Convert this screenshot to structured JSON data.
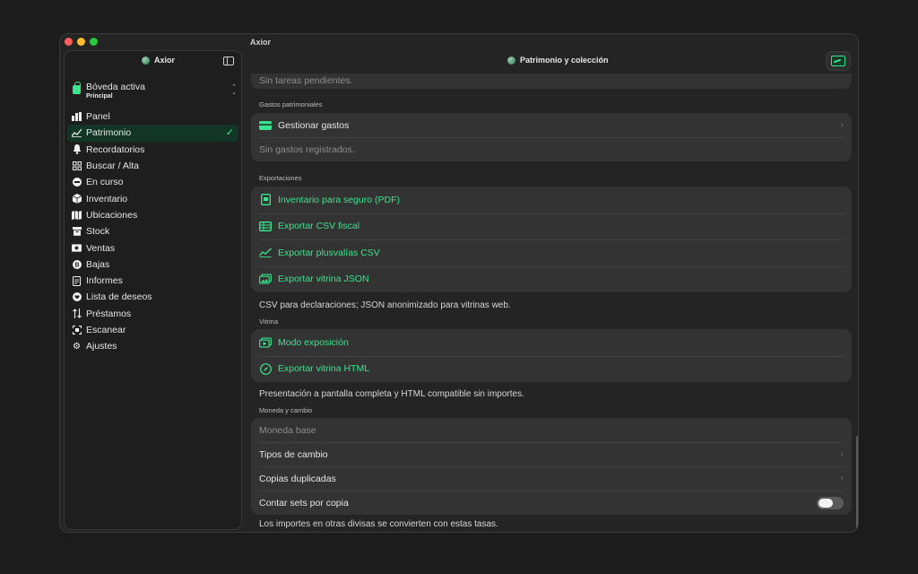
{
  "window": {
    "title": "Axior"
  },
  "sidebar": {
    "brand": "Axior",
    "vault": {
      "title": "Bóveda activa",
      "subtitle": "Principal"
    },
    "items": [
      {
        "label": "Panel",
        "icon": "chart-bars-icon",
        "active": false
      },
      {
        "label": "Patrimonio",
        "icon": "trend-line-icon",
        "active": true
      },
      {
        "label": "Recordatorios",
        "icon": "bell-icon",
        "active": false
      },
      {
        "label": "Buscar / Alta",
        "icon": "grid-icon",
        "active": false
      },
      {
        "label": "En curso",
        "icon": "clock-circle-icon",
        "active": false
      },
      {
        "label": "Inventario",
        "icon": "cube-icon",
        "active": false
      },
      {
        "label": "Ubicaciones",
        "icon": "map-icon",
        "active": false
      },
      {
        "label": "Stock",
        "icon": "archive-box-icon",
        "active": false
      },
      {
        "label": "Ventas",
        "icon": "cash-icon",
        "active": false
      },
      {
        "label": "Bajas",
        "icon": "minus-circle-icon",
        "active": false
      },
      {
        "label": "Informes",
        "icon": "document-icon",
        "active": false
      },
      {
        "label": "Lista de deseos",
        "icon": "heart-icon",
        "active": false
      },
      {
        "label": "Préstamos",
        "icon": "swap-arrows-icon",
        "active": false
      },
      {
        "label": "Escanear",
        "icon": "scan-icon",
        "active": false
      },
      {
        "label": "Ajustes",
        "icon": "gear-icon",
        "active": false
      }
    ]
  },
  "toolbar": {
    "title": "Patrimonio y colección"
  },
  "sections": {
    "pending": {
      "row": "Sin tareas pendientes."
    },
    "expenses": {
      "header": "Gastos patrimoniales",
      "manage": "Gestionar gastos",
      "empty": "Sin gastos registrados."
    },
    "exports": {
      "header": "Exportaciones",
      "items": [
        "Inventario para seguro (PDF)",
        "Exportar CSV fiscal",
        "Exportar plusvalías CSV",
        "Exportar vitrina JSON"
      ],
      "footnote": "CSV para declaraciones; JSON anonimizado para vitrinas web."
    },
    "showcase": {
      "header": "Vitrina",
      "items": [
        "Modo exposición",
        "Exportar vitrina HTML"
      ],
      "footnote": "Presentación a pantalla completa y HTML compatible sin importes."
    },
    "currency": {
      "header": "Moneda y cambio",
      "base": "Moneda base",
      "rates": "Tipos de cambio",
      "duplicates": "Copias duplicadas",
      "count_sets": "Contar sets por copia",
      "count_sets_enabled": false,
      "footnote": "Los importes en otras divisas se convierten con estas tasas."
    }
  },
  "colors": {
    "accent": "#38e58c",
    "active_bg": "#123626",
    "card": "#333333",
    "background": "#242424"
  }
}
